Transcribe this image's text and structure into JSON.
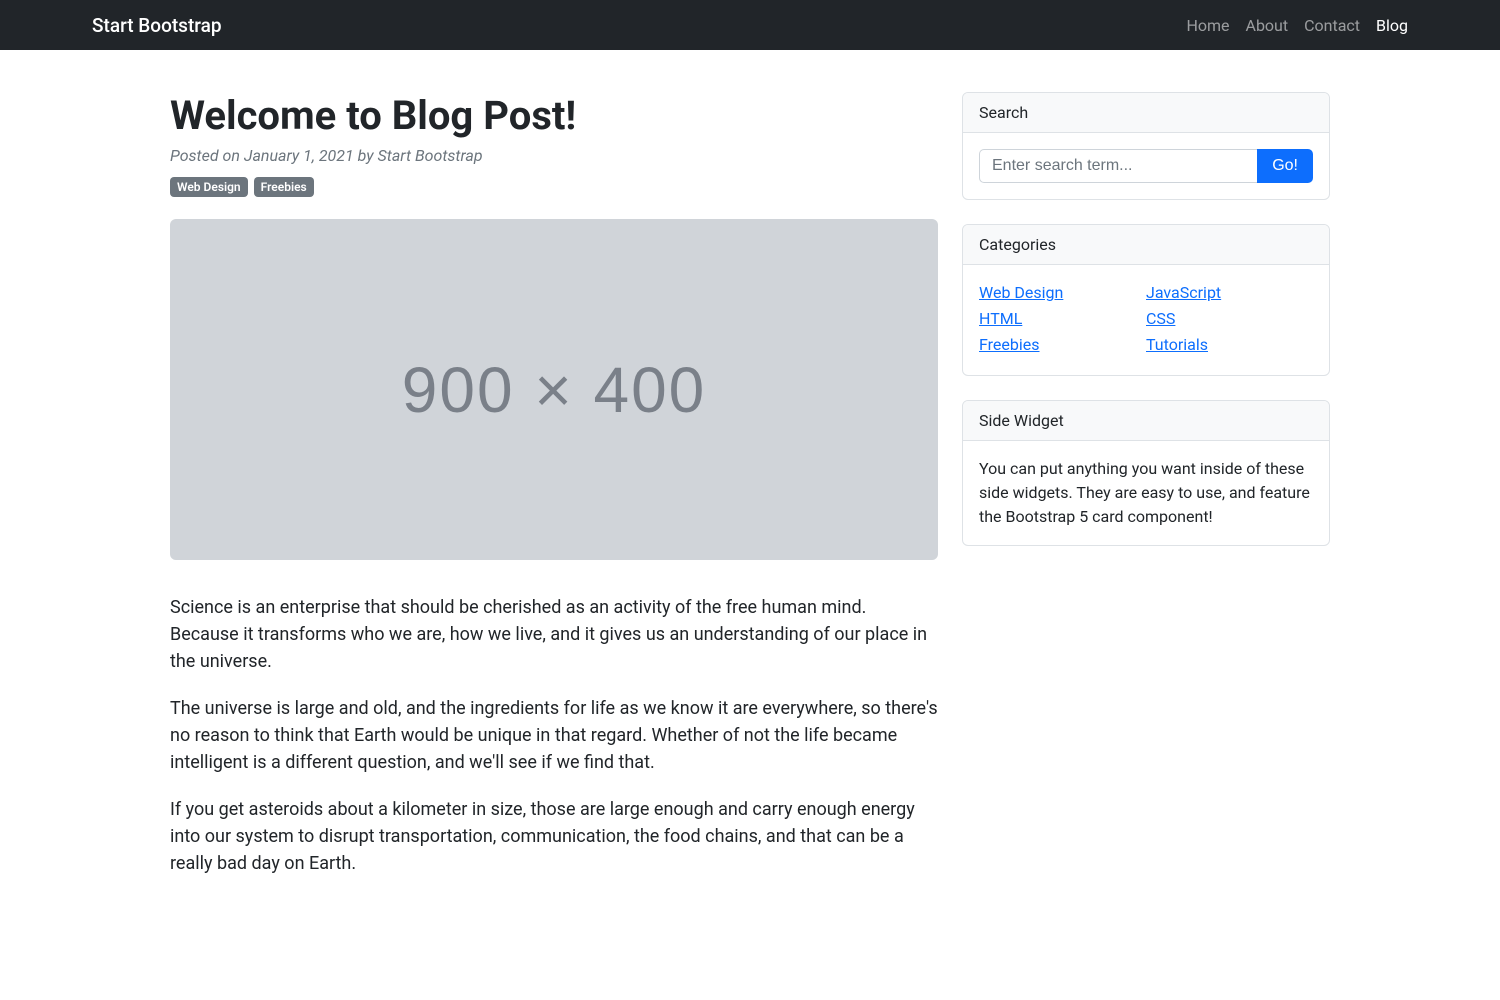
{
  "navbar": {
    "brand": "Start Bootstrap",
    "links": [
      {
        "label": "Home",
        "active": false
      },
      {
        "label": "About",
        "active": false
      },
      {
        "label": "Contact",
        "active": false
      },
      {
        "label": "Blog",
        "active": true
      }
    ]
  },
  "post": {
    "title": "Welcome to Blog Post!",
    "meta": "Posted on January 1, 2021 by Start Bootstrap",
    "tags": [
      "Web Design",
      "Freebies"
    ],
    "hero_dim": "900 × 400",
    "paragraphs": [
      "Science is an enterprise that should be cherished as an activity of the free human mind. Because it transforms who we are, how we live, and it gives us an understanding of our place in the universe.",
      "The universe is large and old, and the ingredients for life as we know it are everywhere, so there's no reason to think that Earth would be unique in that regard. Whether of not the life became intelligent is a different question, and we'll see if we find that.",
      "If you get asteroids about a kilometer in size, those are large enough and carry enough energy into our system to disrupt transportation, communication, the food chains, and that can be a really bad day on Earth."
    ]
  },
  "sidebar": {
    "search": {
      "header": "Search",
      "placeholder": "Enter search term...",
      "button": "Go!"
    },
    "categories": {
      "header": "Categories",
      "col1": [
        "Web Design",
        "HTML",
        "Freebies"
      ],
      "col2": [
        "JavaScript",
        "CSS",
        "Tutorials"
      ]
    },
    "widget": {
      "header": "Side Widget",
      "body": "You can put anything you want inside of these side widgets. They are easy to use, and feature the Bootstrap 5 card component!"
    }
  }
}
